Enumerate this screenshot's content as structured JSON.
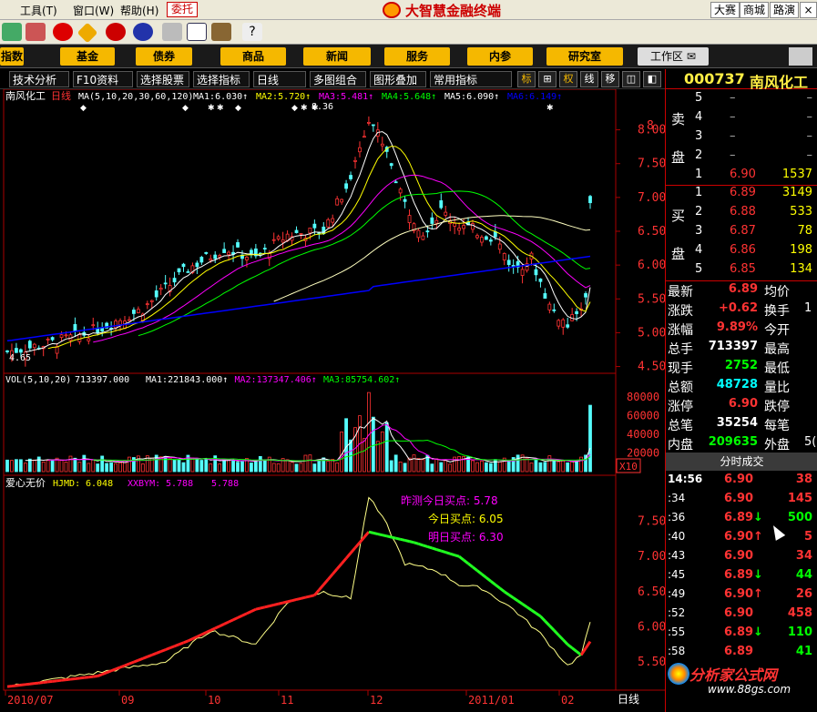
{
  "menu": {
    "items": [
      {
        "label": "工具(T)",
        "key": "tools"
      },
      {
        "label": "窗口(W)",
        "key": "window"
      },
      {
        "label": "帮助(H)",
        "key": "help"
      }
    ],
    "entrust": "委托",
    "brand": "大智慧金融终端",
    "right": [
      "大赛",
      "商城",
      "路演"
    ]
  },
  "nav": {
    "items": [
      "指数",
      "基金",
      "债券",
      "商品",
      "新闻",
      "服务",
      "内参",
      "研究室"
    ],
    "workspace": "工作区"
  },
  "subbar": {
    "tabs": [
      "技术分析",
      "F10资料",
      "选择股票",
      "选择指标",
      "日线",
      "多图组合",
      "图形叠加",
      "常用指标"
    ],
    "icons": [
      "标",
      "⊞",
      "权",
      "线",
      "移",
      "◫",
      "◧"
    ]
  },
  "stock": {
    "code": "000737",
    "name": "南风化工"
  },
  "kpanel": {
    "title": "南风化工",
    "period": "日线",
    "ma_params": "MA(5,10,20,30,60,120)",
    "ma": [
      {
        "label": "MA1:",
        "value": "6.030",
        "color": "#ffffff"
      },
      {
        "label": "MA2:",
        "value": "5.720",
        "color": "#ffff00"
      },
      {
        "label": "MA3:",
        "value": "5.481",
        "color": "#ff00ff"
      },
      {
        "label": "MA4:",
        "value": "5.648",
        "color": "#00ff00"
      },
      {
        "label": "MA5:",
        "value": "6.090",
        "color": "#ffffff"
      },
      {
        "label": "MA6:",
        "value": "6.149",
        "color": "#0000ff"
      }
    ],
    "high_label": "8.36",
    "low_label": "4.65",
    "yticks": [
      "8.00",
      "7.50",
      "7.00",
      "6.50",
      "6.00",
      "5.50",
      "5.00",
      "4.50"
    ]
  },
  "vpanel": {
    "title": "VOL(5,10,20)",
    "vol": "713397.000",
    "ma": [
      {
        "label": "MA1:",
        "value": "221843.000",
        "color": "#ffffff"
      },
      {
        "label": "MA2:",
        "value": "137347.406",
        "color": "#ff00ff"
      },
      {
        "label": "MA3:",
        "value": "85754.602",
        "color": "#00ff00"
      }
    ],
    "yticks": [
      "80000",
      "60000",
      "40000",
      "20000"
    ],
    "unit": "X10"
  },
  "ipanel": {
    "title": "爱心无价",
    "l1": "HJMD:",
    "v1": "6.048",
    "l2": "XXBYM:",
    "v2": "5.788",
    "v3": "5.788",
    "note1": "昨测今日买点: 5.78",
    "note2": "今日买点: 6.05",
    "note3": "明日买点: 6.30",
    "yticks": [
      "7.50",
      "7.00",
      "6.50",
      "6.00",
      "5.50"
    ]
  },
  "xaxis": {
    "labels": [
      "2010/07",
      "09",
      "10",
      "11",
      "12",
      "2011/01",
      "02"
    ],
    "right_label": "日线"
  },
  "orderbook": {
    "sell_label_chars": [
      "卖",
      "盘"
    ],
    "buy_label_chars": [
      "买",
      "盘"
    ],
    "sells": [
      {
        "lvl": "5",
        "price": "–",
        "vol": "–"
      },
      {
        "lvl": "4",
        "price": "–",
        "vol": "–"
      },
      {
        "lvl": "3",
        "price": "–",
        "vol": "–"
      },
      {
        "lvl": "2",
        "price": "–",
        "vol": "–"
      },
      {
        "lvl": "1",
        "price": "6.90",
        "vol": "1537"
      }
    ],
    "buys": [
      {
        "lvl": "1",
        "price": "6.89",
        "vol": "3149"
      },
      {
        "lvl": "2",
        "price": "6.88",
        "vol": "533"
      },
      {
        "lvl": "3",
        "price": "6.87",
        "vol": "78"
      },
      {
        "lvl": "4",
        "price": "6.86",
        "vol": "198"
      },
      {
        "lvl": "5",
        "price": "6.85",
        "vol": "134"
      }
    ]
  },
  "stats": [
    {
      "l": "最新",
      "v": "6.89",
      "vc": "#ff3333",
      "r": "均价"
    },
    {
      "l": "涨跌",
      "v": "+0.62",
      "vc": "#ff3333",
      "r": "换手",
      "rv": "1"
    },
    {
      "l": "涨幅",
      "v": "9.89%",
      "vc": "#ff3333",
      "r": "今开"
    },
    {
      "l": "总手",
      "v": "713397",
      "vc": "#ffffff",
      "r": "最高"
    },
    {
      "l": "现手",
      "v": "2752",
      "vc": "#00ff00",
      "r": "最低"
    },
    {
      "l": "总额",
      "v": "48728",
      "vc": "#00ffff",
      "r": "量比"
    },
    {
      "l": "涨停",
      "v": "6.90",
      "vc": "#ff3333",
      "r": "跌停"
    },
    {
      "l": "总笔",
      "v": "35254",
      "vc": "#ffffff",
      "r": "每笔"
    },
    {
      "l": "内盘",
      "v": "209635",
      "vc": "#00ff00",
      "r": "外盘",
      "rv": "5("
    }
  ],
  "tape": {
    "title": "分时成交",
    "rows": [
      {
        "t": "14:56",
        "p": "6.90",
        "pc": "#ff3333",
        "a": "",
        "v": "38",
        "vc": "#ff3333"
      },
      {
        "t": ":34",
        "p": "6.90",
        "pc": "#ff3333",
        "a": "",
        "v": "145",
        "vc": "#ff3333"
      },
      {
        "t": ":36",
        "p": "6.89",
        "pc": "#ff3333",
        "a": "↓",
        "ac": "#00ff00",
        "v": "500",
        "vc": "#00ff00"
      },
      {
        "t": ":40",
        "p": "6.90",
        "pc": "#ff3333",
        "a": "↑",
        "ac": "#ff3333",
        "v": "5",
        "vc": "#ff3333"
      },
      {
        "t": ":43",
        "p": "6.90",
        "pc": "#ff3333",
        "a": "",
        "v": "34",
        "vc": "#ff3333"
      },
      {
        "t": ":45",
        "p": "6.89",
        "pc": "#ff3333",
        "a": "↓",
        "ac": "#00ff00",
        "v": "44",
        "vc": "#00ff00"
      },
      {
        "t": ":49",
        "p": "6.90",
        "pc": "#ff3333",
        "a": "↑",
        "ac": "#ff3333",
        "v": "26",
        "vc": "#ff3333"
      },
      {
        "t": ":52",
        "p": "6.90",
        "pc": "#ff3333",
        "a": "",
        "v": "458",
        "vc": "#ff3333"
      },
      {
        "t": ":55",
        "p": "6.89",
        "pc": "#ff3333",
        "a": "↓",
        "ac": "#00ff00",
        "v": "110",
        "vc": "#00ff00"
      },
      {
        "t": ":58",
        "p": "6.89",
        "pc": "#ff3333",
        "a": "",
        "v": "41",
        "vc": "#00ff00"
      }
    ]
  },
  "watermark": {
    "title": "分析家公式网",
    "url": "www.88gs.com"
  },
  "colors": {
    "up": "#ff3333",
    "down": "#00ffff",
    "ma1": "#ffffff",
    "ma2": "#ffff00",
    "ma3": "#ff00ff",
    "ma4": "#00ff00",
    "ma5": "#ffffc0",
    "ma6": "#0000ff",
    "accent": "#f5b800"
  }
}
